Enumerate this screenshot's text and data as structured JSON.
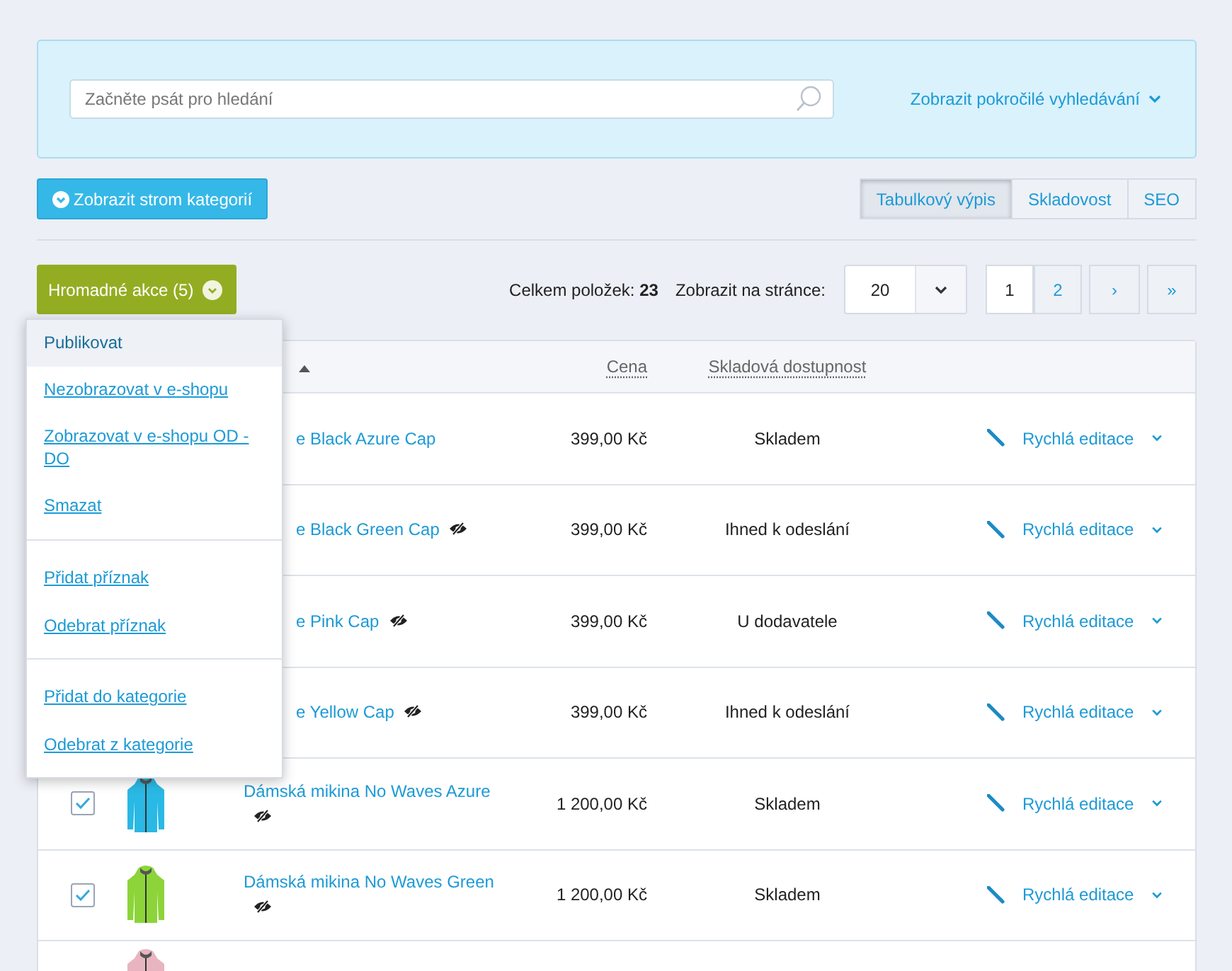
{
  "search": {
    "placeholder": "Začněte psát pro hledání",
    "advanced_link": "Zobrazit pokročilé vyhledávání"
  },
  "category_tree_button": "Zobrazit strom kategorií",
  "view_tabs": [
    {
      "label": "Tabulkový výpis",
      "selected": true
    },
    {
      "label": "Skladovost",
      "selected": false
    },
    {
      "label": "SEO",
      "selected": false
    }
  ],
  "bulk_button": "Hromadné akce (5)",
  "bulk_menu": [
    [
      {
        "label": "Publikovat",
        "selected": true
      },
      {
        "label": "Nezobrazovat v e-shopu",
        "selected": false
      },
      {
        "label": "Zobrazovat v e-shopu OD - DO",
        "selected": false
      },
      {
        "label": "Smazat",
        "selected": false
      }
    ],
    [
      {
        "label": "Přidat příznak",
        "selected": false
      },
      {
        "label": "Odebrat příznak",
        "selected": false
      }
    ],
    [
      {
        "label": "Přidat do kategorie",
        "selected": false
      },
      {
        "label": "Odebrat z kategorie",
        "selected": false
      }
    ]
  ],
  "total_label": "Celkem položek:",
  "total_value": "23",
  "per_page_label": "Zobrazit na stránce:",
  "per_page": "20",
  "pagination": [
    {
      "label": "1",
      "selected": true
    },
    {
      "label": "2",
      "selected": false
    },
    {
      "label": "›",
      "selected": false
    },
    {
      "label": "»",
      "selected": false
    }
  ],
  "table": {
    "columns": [
      "Cena",
      "Skladová dostupnost"
    ],
    "rows": [
      {
        "kind": "under_menu",
        "name": "e Black Azure Cap",
        "hidden": false,
        "price": "399,00 Kč",
        "stock": "Skladem",
        "action": "Rychlá editace"
      },
      {
        "kind": "under_menu",
        "name": "e Black Green Cap",
        "hidden": true,
        "price": "399,00 Kč",
        "stock": "Ihned k odeslání",
        "action": "Rychlá editace"
      },
      {
        "kind": "under_menu",
        "name": "e Pink Cap",
        "hidden": true,
        "price": "399,00 Kč",
        "stock": "U dodavatele",
        "action": "Rychlá editace"
      },
      {
        "kind": "under_menu",
        "name": "e Yellow Cap",
        "hidden": true,
        "price": "399,00 Kč",
        "stock": "Ihned k odeslání",
        "action": "Rychlá editace"
      },
      {
        "kind": "full",
        "checked": true,
        "color": "#2ab8e4",
        "name": "Dámská mikina No Waves Azure",
        "hidden": true,
        "price": "1 200,00 Kč",
        "stock": "Skladem",
        "action": "Rychlá editace"
      },
      {
        "kind": "full",
        "checked": true,
        "color": "#8cd43a",
        "name": "Dámská mikina No Waves Green",
        "hidden": true,
        "price": "1 200,00 Kč",
        "stock": "Skladem",
        "action": "Rychlá editace"
      },
      {
        "kind": "partial",
        "color": "#e8b4c0"
      }
    ]
  }
}
